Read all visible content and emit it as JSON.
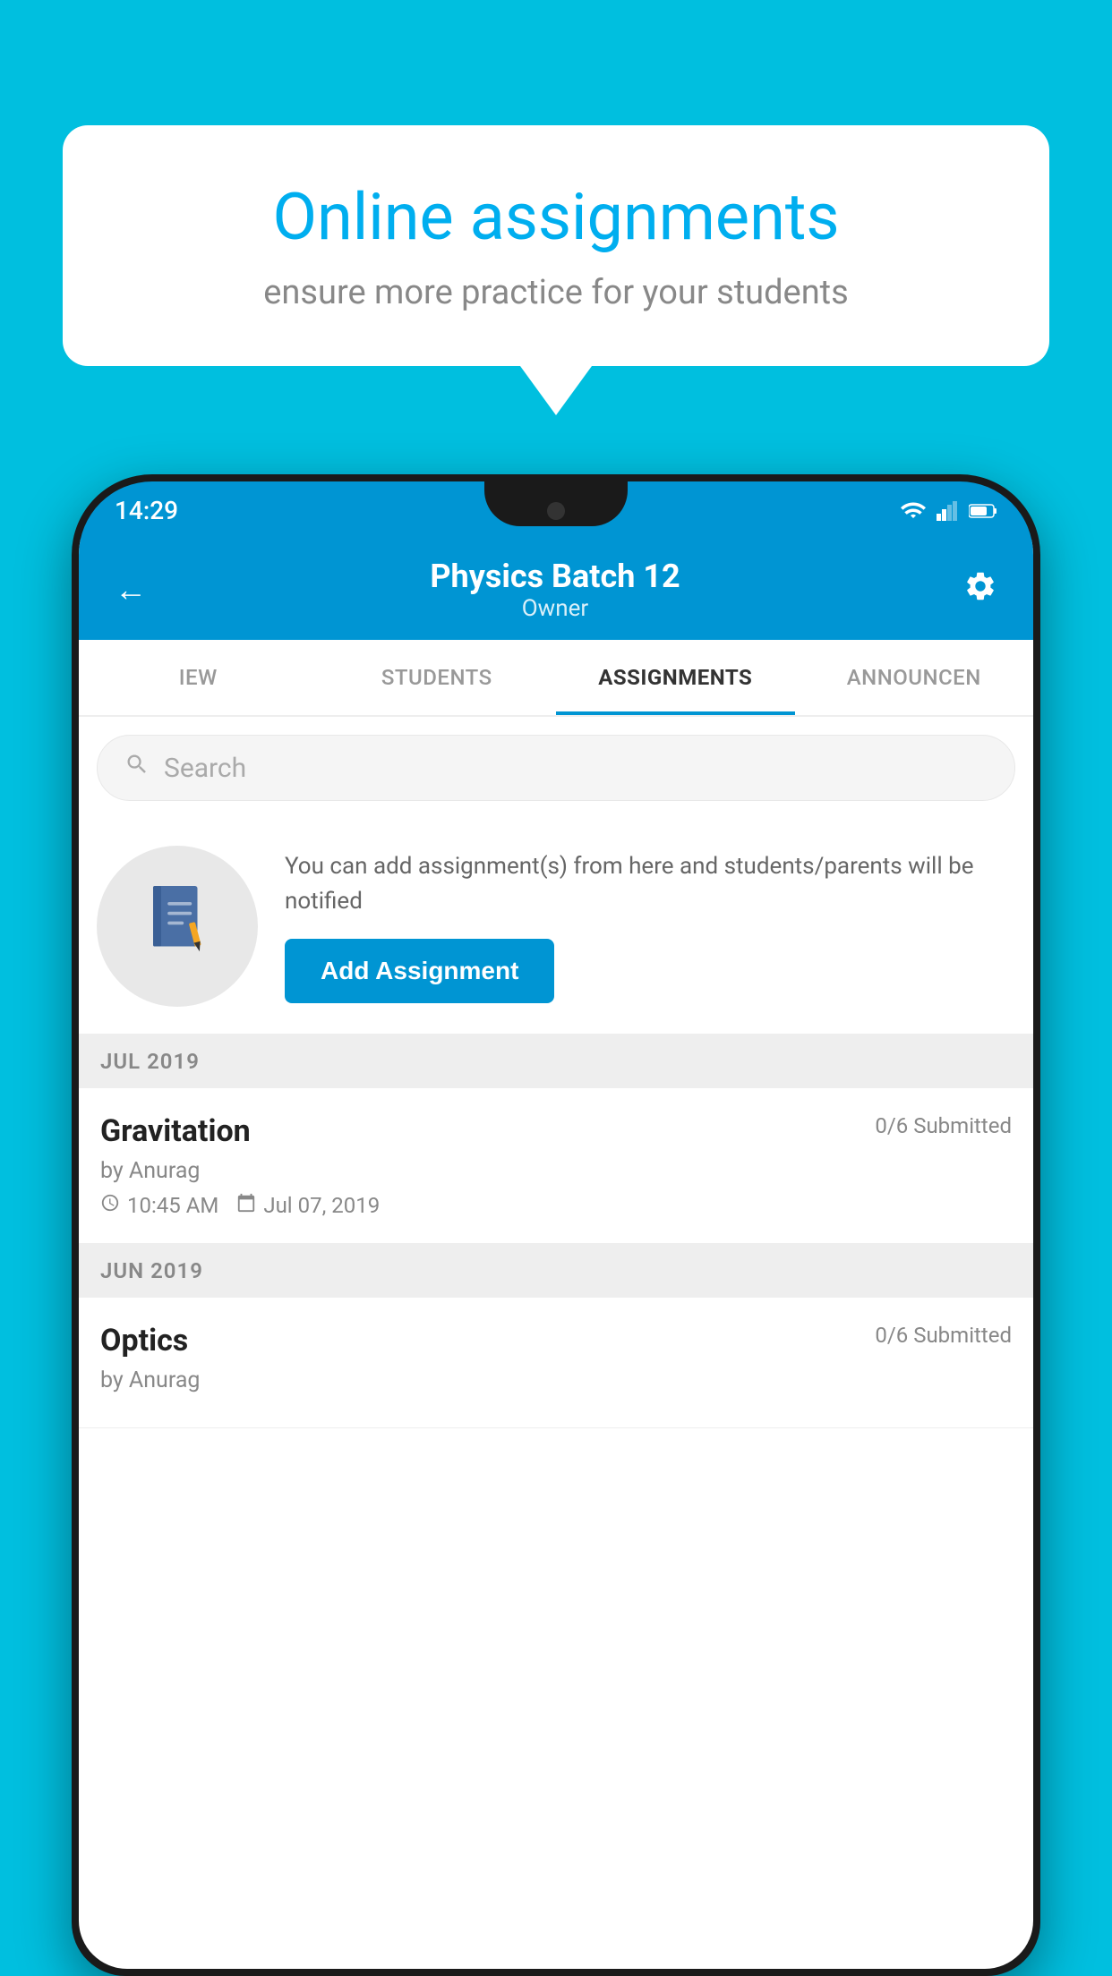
{
  "background": {
    "color": "#00BFDF"
  },
  "speech_bubble": {
    "title": "Online assignments",
    "subtitle": "ensure more practice for your students"
  },
  "status_bar": {
    "time": "14:29"
  },
  "app_header": {
    "title": "Physics Batch 12",
    "subtitle": "Owner",
    "back_label": "←",
    "settings_label": "⚙"
  },
  "tabs": [
    {
      "label": "IEW",
      "active": false
    },
    {
      "label": "STUDENTS",
      "active": false
    },
    {
      "label": "ASSIGNMENTS",
      "active": true
    },
    {
      "label": "ANNOUNCEN",
      "active": false
    }
  ],
  "search": {
    "placeholder": "Search"
  },
  "promo": {
    "text": "You can add assignment(s) from here and students/parents will be notified",
    "button_label": "Add Assignment"
  },
  "sections": [
    {
      "header": "JUL 2019",
      "assignments": [
        {
          "title": "Gravitation",
          "submitted": "0/6 Submitted",
          "author": "by Anurag",
          "time": "10:45 AM",
          "date": "Jul 07, 2019"
        }
      ]
    },
    {
      "header": "JUN 2019",
      "assignments": [
        {
          "title": "Optics",
          "submitted": "0/6 Submitted",
          "author": "by Anurag",
          "time": "",
          "date": ""
        }
      ]
    }
  ]
}
